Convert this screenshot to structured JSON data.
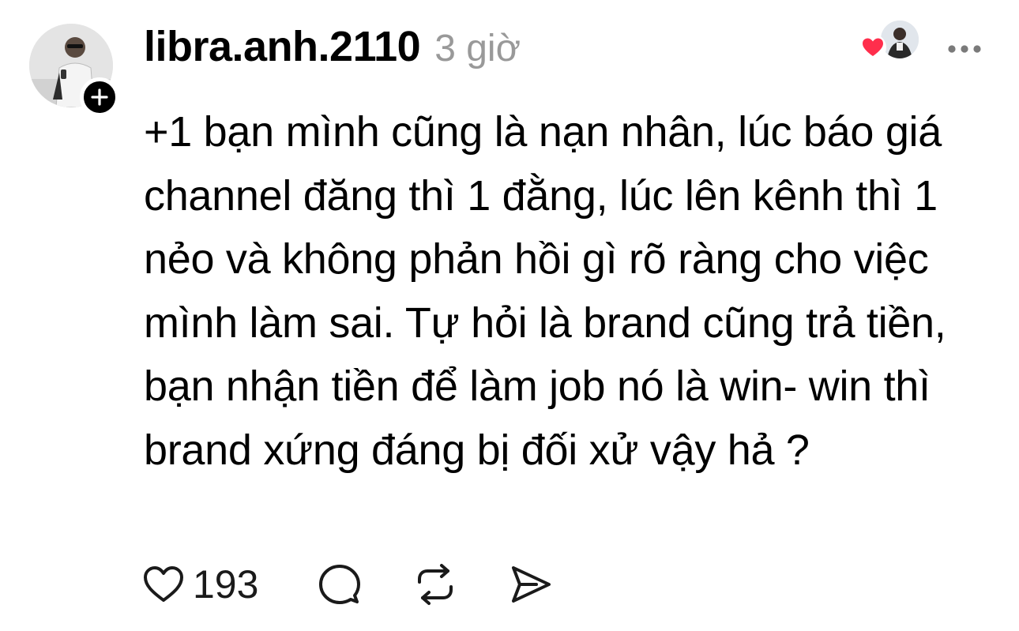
{
  "post": {
    "author": "libra.anh.2110",
    "time": "3 giờ",
    "text": "+1 bạn mình cũng là nạn nhân, lúc báo giá channel đăng thì 1 đằng, lúc lên kênh thì 1 nẻo và không phản hồi gì rõ ràng cho việc mình làm sai. Tự hỏi là brand cũng trả tiền, bạn nhận tiền để làm job nó là win- win thì brand xứng đáng bị đối xử vậy hả ?",
    "like_count": "193"
  },
  "icons": {
    "avatar": "profile-photo",
    "follow": "plus-icon",
    "liked_by": "heart-icon",
    "more": "ellipsis-icon",
    "like": "heart-outline-icon",
    "comment": "comment-bubble-icon",
    "repost": "repost-icon",
    "share": "send-icon"
  },
  "colors": {
    "text": "#000000",
    "muted": "#999999",
    "heart": "#ff2e4c"
  }
}
